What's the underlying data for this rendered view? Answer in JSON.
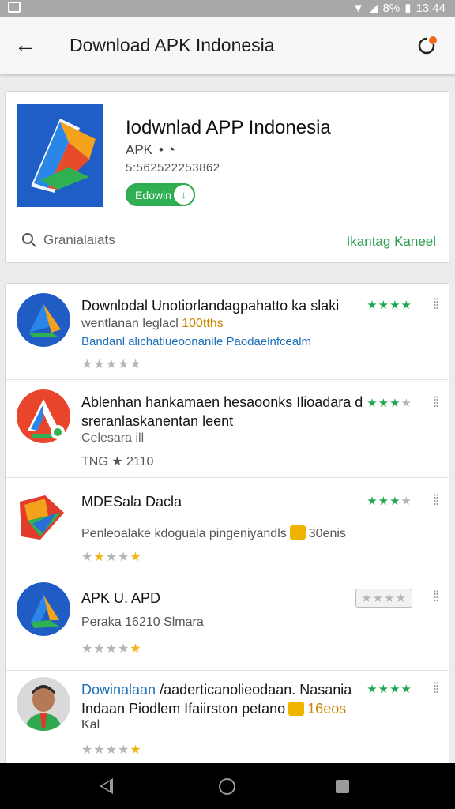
{
  "status": {
    "battery": "8%",
    "time": "13:44"
  },
  "appbar": {
    "title": "Download APK Indonesia"
  },
  "featured": {
    "name": "Iodwnlad APP Indonesia",
    "sub": "APK",
    "number": "5:562522253862",
    "button": "Edowin",
    "search_placeholder": "Granialaiats",
    "link": "Ikantag Kaneel"
  },
  "list": [
    {
      "line1": "Downlodal Unotiorlandagpahatto ka slaki",
      "line2a": "wentlanan leglacl",
      "line2b": "100tths",
      "line3": "Bandanl alichatiueoonanile Paodaelnfcealm"
    },
    {
      "line1": "Ablenhan hankamaen hesaoonks Ilioadara d",
      "line2": "sreranlaskanentan leent",
      "line3": "Celesara ill",
      "line4": "TNG ★ 2110"
    },
    {
      "line1": "MDESala Dacla",
      "line2a": "Penleoalake kdoguala pingeniyandls",
      "line2b": "30enis"
    },
    {
      "line1": "APK U. APD",
      "line2": "Peraka 16210 Slmara"
    },
    {
      "line1a": "Dowinalaan",
      "line1b": "/aaderticanolieodaan. Nasania",
      "line2a": "Indaan Piodlem Ifaiirston petano",
      "line2b": "16eos",
      "line3": "Kal"
    }
  ]
}
